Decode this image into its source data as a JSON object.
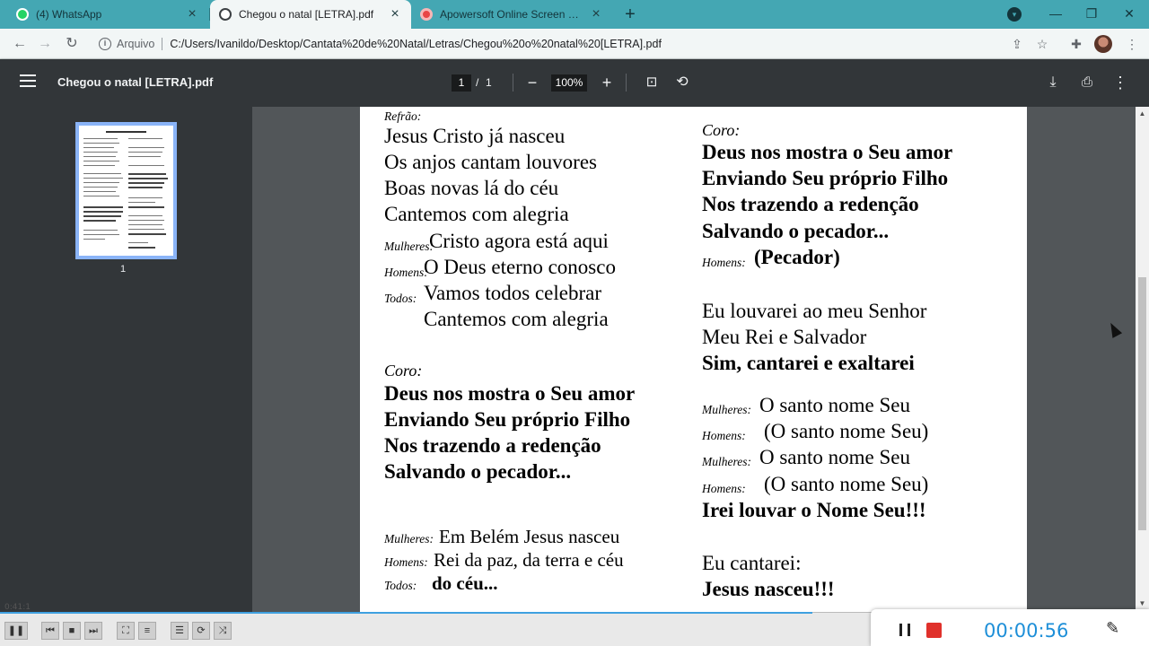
{
  "browser": {
    "tabs": [
      {
        "title": "(4) WhatsApp",
        "active": false,
        "icon": "whatsapp-icon"
      },
      {
        "title": "Chegou o natal [LETRA].pdf",
        "active": true,
        "icon": "globe-icon"
      },
      {
        "title": "Apowersoft Online Screen Recorder",
        "active": false,
        "icon": "apowersoft-icon"
      }
    ],
    "new_tab_label": "+",
    "address": {
      "scheme_label": "Arquivo",
      "url": "C:/Users/Ivanildo/Desktop/Cantata%20de%20Natal/Letras/Chegou%20o%20natal%20[LETRA].pdf"
    }
  },
  "pdf": {
    "title": "Chegou o natal [LETRA].pdf",
    "current_page": "1",
    "page_separator": "/",
    "total_pages": "1",
    "zoom": "100%",
    "thumbnail_label": "1"
  },
  "lyrics": {
    "left": {
      "refrao_label": "Refrão:",
      "refrao": [
        "Jesus Cristo já nasceu",
        "Os anjos cantam louvores",
        "Boas novas lá do céu",
        "Cantemos com alegria"
      ],
      "mulheres1_label": "Mulheres:",
      "mulheres1": "Cristo agora está aqui",
      "homens1_label": "Homens:",
      "homens1": "O Deus eterno conosco",
      "todos1_label": "Todos:",
      "todos1": [
        "Vamos todos celebrar",
        "Cantemos com alegria"
      ],
      "coro_label": "Coro:",
      "coro": [
        "Deus nos mostra o Seu amor",
        "Enviando Seu próprio Filho",
        "Nos trazendo a redenção",
        "Salvando o pecador..."
      ],
      "mulheres2_label": "Mulheres:",
      "mulheres2": "Em Belém Jesus nasceu",
      "homens2_label": "Homens:",
      "homens2": "Rei da paz, da terra e céu",
      "todos2_label": "Todos:",
      "todos2": "do céu..."
    },
    "right": {
      "coro_label": "Coro:",
      "coro": [
        "Deus nos mostra o Seu amor",
        "Enviando Seu próprio Filho",
        "Nos trazendo a redenção",
        "Salvando o pecador..."
      ],
      "homens_label": "Homens:",
      "homens": "(Pecador)",
      "verse": [
        "Eu louvarei ao meu Senhor",
        "Meu Rei e Salvador"
      ],
      "verse_bold": "Sim, cantarei e exaltarei",
      "mulheres_label": "Mulheres:",
      "santo": "O santo nome Seu",
      "homens_label2": "Homens:",
      "santo_echo": "(O santo nome Seu)",
      "irei": "Irei louvar o Nome Seu!!!",
      "cantarei": "Eu cantarei:",
      "nasceu": "Jesus nasceu!!!"
    }
  },
  "recorder": {
    "timer": "00:00:56"
  },
  "player": {
    "elapsed_time": "0:41:1"
  },
  "colors": {
    "tabstrip": "#44a7b3",
    "pdf_toolbar": "#323639",
    "viewer_bg": "#525659",
    "timer": "#1e8fd8",
    "stop": "#e0312b"
  }
}
